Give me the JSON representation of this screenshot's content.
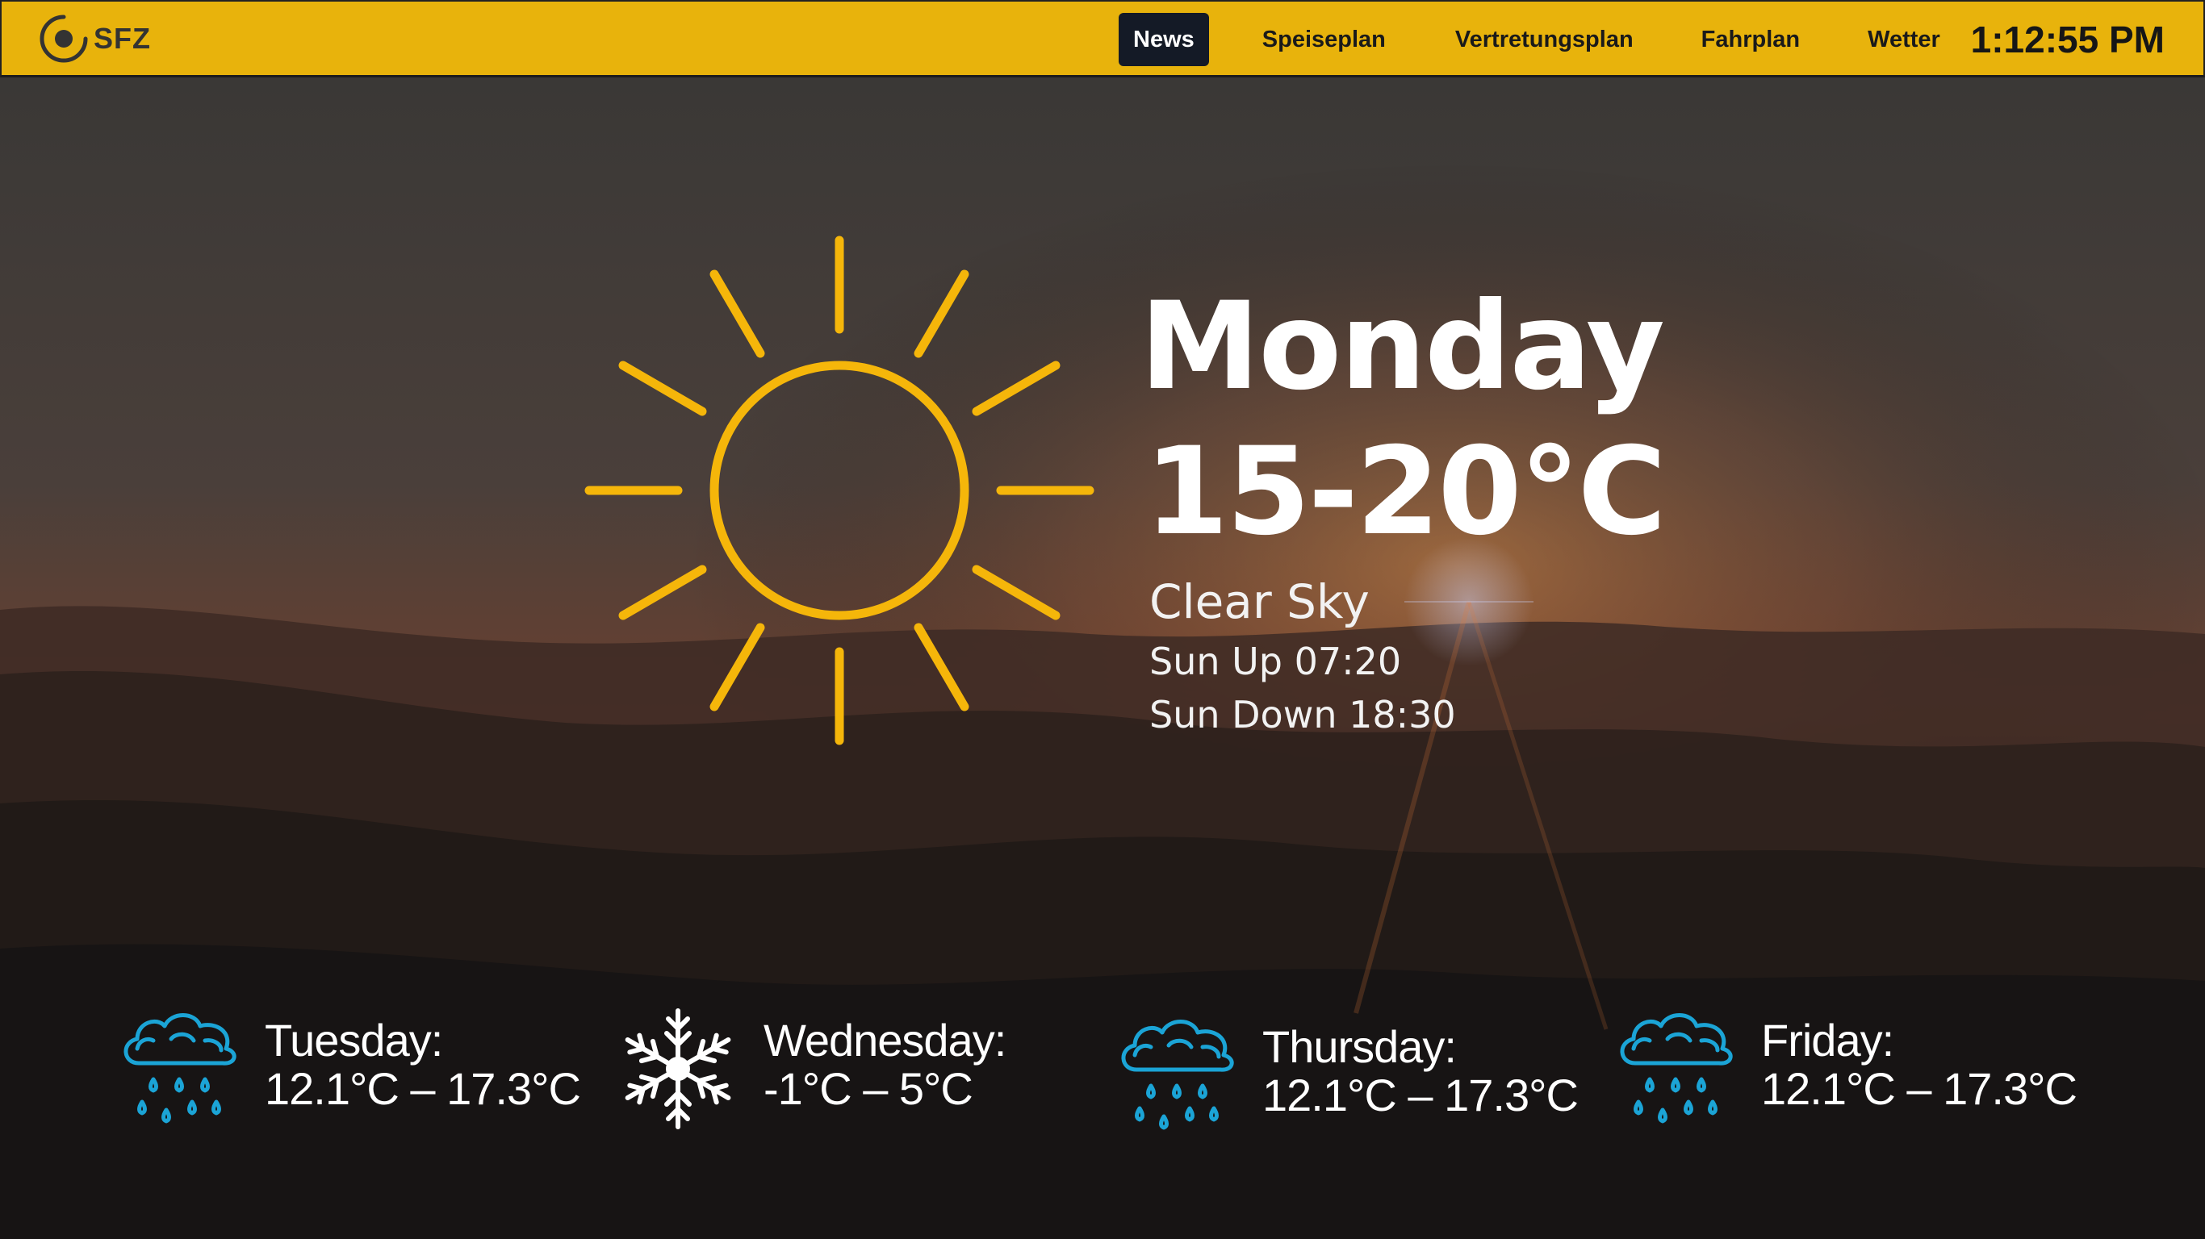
{
  "app": {
    "logo_text": "SFZ"
  },
  "nav": {
    "items": [
      {
        "label": "News",
        "active": true
      },
      {
        "label": "Speiseplan",
        "active": false
      },
      {
        "label": "Vertretungsplan",
        "active": false
      },
      {
        "label": "Fahrplan",
        "active": false
      },
      {
        "label": "Wetter",
        "active": false
      }
    ]
  },
  "clock": "1:12:55 PM",
  "today": {
    "day": "Monday",
    "temp_range": "15-20°C",
    "condition": "Clear Sky",
    "sun_up": "Sun Up 07:20",
    "sun_down": "Sun Down 18:30",
    "icon": "sun-icon"
  },
  "forecast": [
    {
      "day": "Tuesday:",
      "range": "12.1°C – 17.3°C",
      "icon": "rain-cloud-icon"
    },
    {
      "day": "Wednesday:",
      "range": "-1°C – 5°C",
      "icon": "snowflake-icon"
    },
    {
      "day": "Thursday:",
      "range": "12.1°C – 17.3°C",
      "icon": "rain-cloud-icon"
    },
    {
      "day": "Friday:",
      "range": "12.1°C – 17.3°C",
      "icon": "rain-cloud-icon"
    }
  ],
  "colors": {
    "topbar": "#e8b30c",
    "nav_active_bg": "#141a26",
    "sun": "#f5b60a",
    "rain_icon": "#1ba4d6",
    "text": "#ffffff"
  }
}
